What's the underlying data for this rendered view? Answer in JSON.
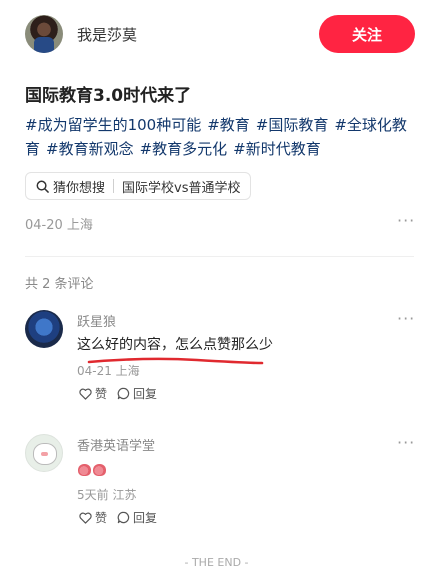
{
  "post": {
    "author": "我是莎莫",
    "follow_label": "关注",
    "title": "国际教育3.0时代来了",
    "tags": [
      "#成为留学生的100种可能",
      "#教育",
      "#国际教育",
      "#全球化教",
      "育",
      "#教育新观念",
      "#教育多元化",
      "#新时代教育"
    ],
    "search_chip": {
      "prefix": "猜你想搜",
      "query": "国际学校vs普通学校"
    },
    "date_location": "04-20 上海",
    "more": "···"
  },
  "comments_header": "共 2 条评论",
  "comments": [
    {
      "name": "跃星狼",
      "text": "这么好的内容，怎么点赞那么少",
      "time_location": "04-21 上海",
      "like_label": "赞",
      "reply_label": "回复",
      "more": "···"
    },
    {
      "name": "香港英语学堂",
      "text": "",
      "time_location": "5天前 江苏",
      "like_label": "赞",
      "reply_label": "回复",
      "more": "···"
    }
  ],
  "footer": "- THE END -",
  "colors": {
    "accent": "#ff2442",
    "tag": "#13386c",
    "annotation_line": "#e0292f"
  }
}
